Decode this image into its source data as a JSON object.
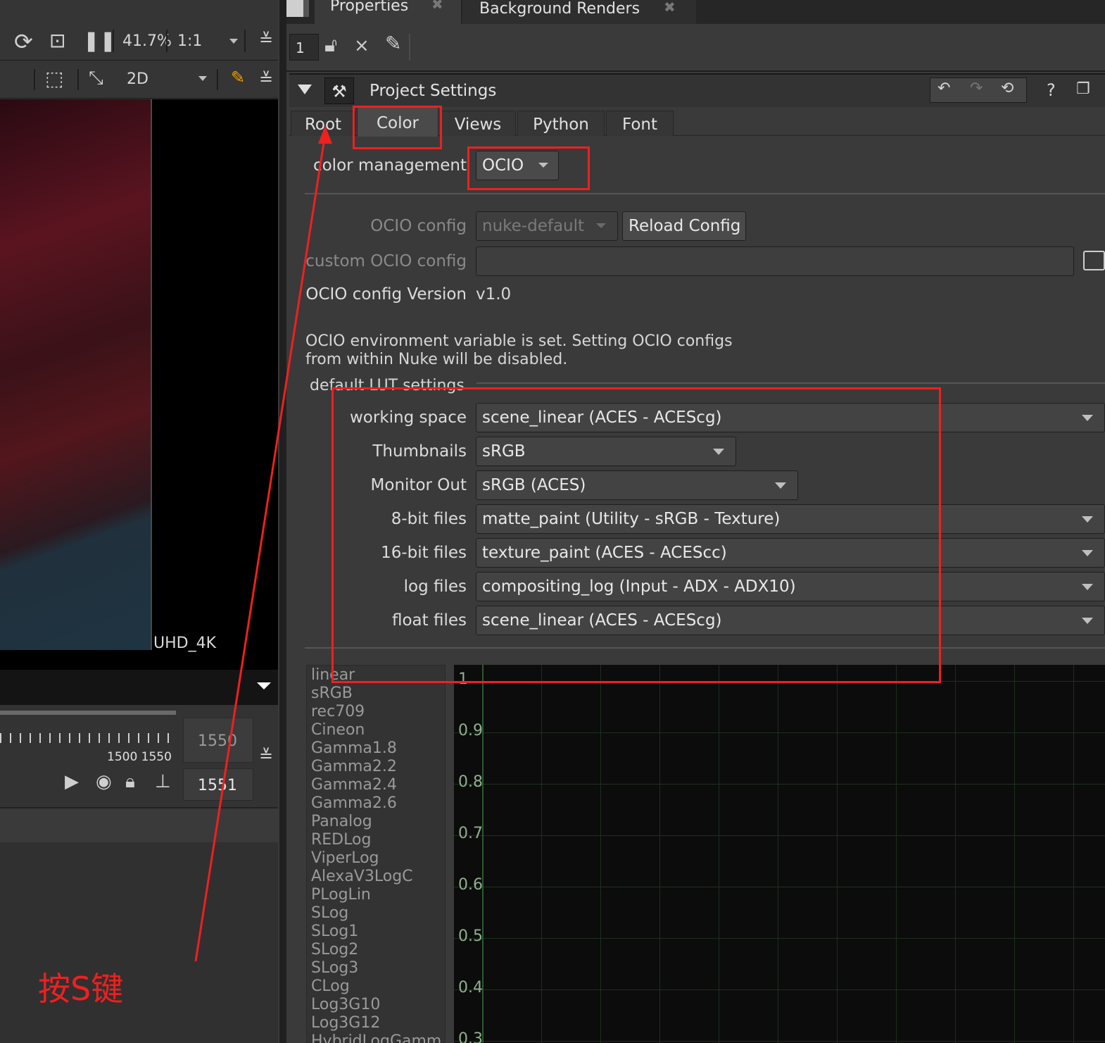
{
  "viewer": {
    "zoom_value": "41.7%",
    "ratio_value": "1:1",
    "view_mode": "2D",
    "format_label": "UHD_4K",
    "timeline_ticks": "1500 1550",
    "frame_top": "1550",
    "frame_bottom": "1551"
  },
  "tabs": {
    "properties": "Properties",
    "background_renders": "Background Renders"
  },
  "toolbar": {
    "max_panels": "1"
  },
  "panel": {
    "title": "Project Settings",
    "help": "?",
    "subtabs": [
      "Root",
      "Color",
      "Views",
      "Python",
      "Font"
    ]
  },
  "color": {
    "color_management_label": "color management",
    "color_management_value": "OCIO",
    "ocio_config_label": "OCIO config",
    "ocio_config_value": "nuke-default",
    "reload_button": "Reload Config",
    "custom_label": "custom OCIO config",
    "custom_value": "",
    "version_label": "OCIO config Version",
    "version_value": "v1.0",
    "env_message_1": "OCIO environment variable is set. Setting OCIO configs",
    "env_message_2": "from within Nuke will be disabled.",
    "lut_group_label": "default LUT settings",
    "lut_rows": [
      {
        "label": "working space",
        "value": "scene_linear (ACES - ACEScg)"
      },
      {
        "label": "Thumbnails",
        "value": "sRGB"
      },
      {
        "label": "Monitor Out",
        "value": "sRGB (ACES)"
      },
      {
        "label": "8-bit files",
        "value": "matte_paint (Utility - sRGB - Texture)"
      },
      {
        "label": "16-bit files",
        "value": "texture_paint (ACES - ACEScc)"
      },
      {
        "label": "log files",
        "value": "compositing_log (Input - ADX - ADX10)"
      },
      {
        "label": "float files",
        "value": "scene_linear (ACES - ACEScg)"
      }
    ]
  },
  "lut_list": [
    "linear",
    "sRGB",
    "rec709",
    "Cineon",
    "Gamma1.8",
    "Gamma2.2",
    "Gamma2.4",
    "Gamma2.6",
    "Panalog",
    "REDLog",
    "ViperLog",
    "AlexaV3LogC",
    "PLogLin",
    "SLog",
    "SLog1",
    "SLog2",
    "SLog3",
    "CLog",
    "Log3G10",
    "Log3G12",
    "HybridLogGamm"
  ],
  "curve_y_labels": [
    "1",
    "0.9",
    "0.8",
    "0.7",
    "0.6",
    "0.5",
    "0.4",
    "0.3"
  ],
  "annotation": {
    "text": "按S键",
    "color": "#ee2020"
  }
}
